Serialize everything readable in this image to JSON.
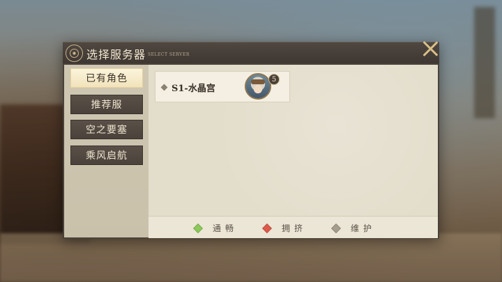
{
  "dialog": {
    "title": "选择服务器",
    "subtitle": "SELECT SERVER"
  },
  "sidebar": {
    "tabs": [
      {
        "label": "已有角色",
        "active": true
      },
      {
        "label": "推荐服",
        "active": false
      },
      {
        "label": "空之要塞",
        "active": false
      },
      {
        "label": "乘风启航",
        "active": false
      }
    ]
  },
  "servers": [
    {
      "name": "S1-水晶宫",
      "level": "5",
      "status_icon": "diamond-icon"
    }
  ],
  "legend": [
    {
      "label": "通畅",
      "color": "#8cc85a"
    },
    {
      "label": "拥挤",
      "color": "#dd5b4c"
    },
    {
      "label": "维护",
      "color": "#a69d8d"
    }
  ],
  "colors": {
    "header_bg": "#3e3731",
    "active_tab_bg": "#f1e3bb",
    "tab_bg": "#4a423b",
    "panel_bg": "#e3ddcb",
    "accent": "#d8bf88"
  }
}
